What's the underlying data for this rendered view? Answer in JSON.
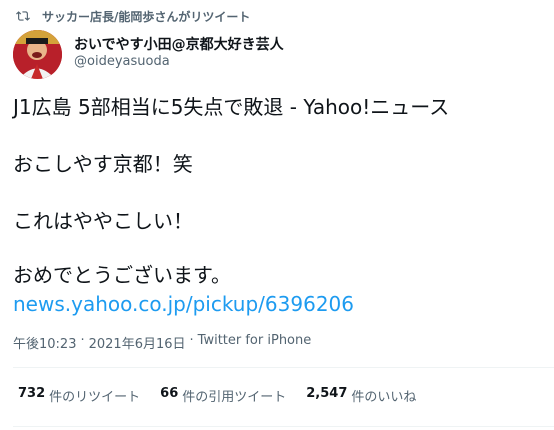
{
  "retweet": {
    "label": "サッカー店長/能岡歩さんがリツイート",
    "icon": "retweet-icon"
  },
  "author": {
    "display_name": "おいでやす小田@京都大好き芸人",
    "handle": "@oideyasuoda",
    "avatar_icon": "avatar"
  },
  "tweet": {
    "line1": "J1広島 5部相当に5失点で敗退 - Yahoo!ニュース",
    "line2": "おこしやす京都！笑",
    "line3": "これはややこしい！",
    "line4": "おめでとうございます。",
    "link": "news.yahoo.co.jp/pickup/6396206"
  },
  "meta": {
    "time": "午後10:23",
    "separator": "·",
    "date": "2021年6月16日",
    "source": "Twitter for iPhone"
  },
  "stats": {
    "retweets_count": "732",
    "retweets_label": "件のリツイート",
    "quotes_count": "66",
    "quotes_label": "件の引用ツイート",
    "likes_count": "2,547",
    "likes_label": "件のいいね"
  },
  "colors": {
    "link": "#1d9bf0",
    "secondary_text": "#536471",
    "primary_text": "#0f1419",
    "divider": "#eff3f4"
  }
}
